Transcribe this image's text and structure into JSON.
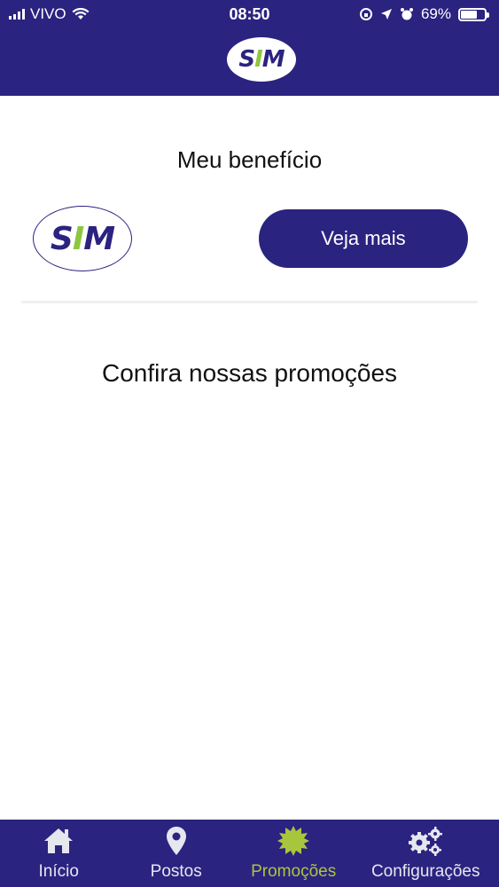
{
  "status_bar": {
    "carrier": "VIVO",
    "time": "08:50",
    "battery": "69%",
    "battery_level": 0.69
  },
  "header": {
    "logo_text": "SIM"
  },
  "benefit": {
    "title": "Meu benefício",
    "logo_text": "SIM",
    "button_label": "Veja mais"
  },
  "promotions": {
    "title": "Confira nossas promoções"
  },
  "tabs": [
    {
      "label": "Início",
      "icon": "home-icon"
    },
    {
      "label": "Postos",
      "icon": "map-pin-icon"
    },
    {
      "label": "Promoções",
      "icon": "badge-icon",
      "active": true
    },
    {
      "label": "Configurações",
      "icon": "gears-icon"
    }
  ],
  "colors": {
    "brand": "#2b2380",
    "accent": "#a8c63c",
    "logo_green": "#8dc63f"
  }
}
